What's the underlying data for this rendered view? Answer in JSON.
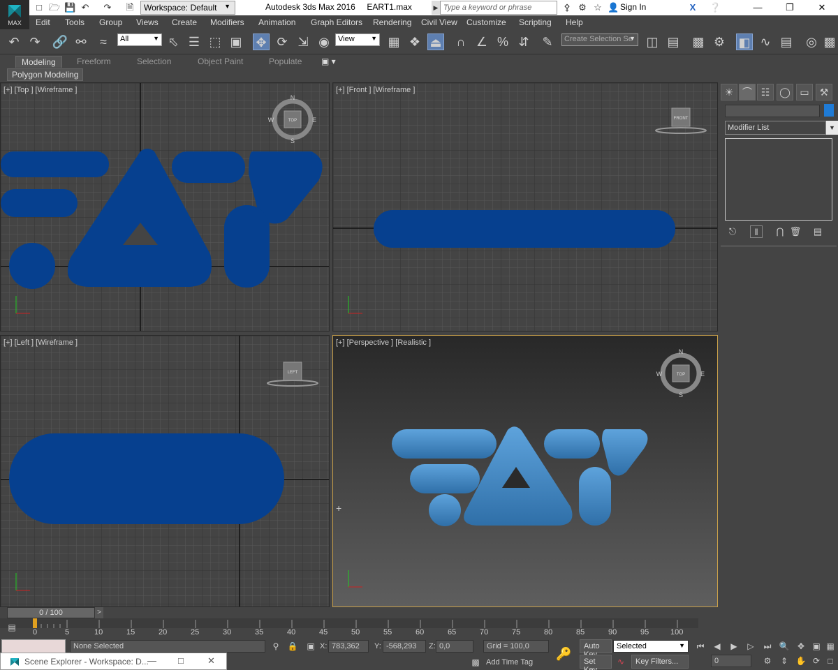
{
  "app": {
    "logo_label": "MAX",
    "title": "Autodesk 3ds Max 2016     EART1.max",
    "workspace": "Workspace: Default",
    "search_placeholder": "Type a keyword or phrase",
    "sign_in": "Sign In"
  },
  "menu": [
    "Edit",
    "Tools",
    "Group",
    "Views",
    "Create",
    "Modifiers",
    "Animation",
    "Graph Editors",
    "Rendering",
    "Civil View",
    "Customize",
    "Scripting",
    "Help"
  ],
  "toolbar": {
    "selection_filter": "All",
    "reference_coord": "View",
    "named_selection_placeholder": "Create Selection Se"
  },
  "ribbon": {
    "tabs": [
      "Modeling",
      "Freeform",
      "Selection",
      "Object Paint",
      "Populate"
    ],
    "active_tab": "Modeling",
    "panel": "Polygon Modeling"
  },
  "viewports": {
    "top": {
      "label": "[+] [Top ] [Wireframe ]",
      "cube": "TOP"
    },
    "front": {
      "label": "[+] [Front ] [Wireframe ]",
      "cube": "FRONT"
    },
    "left": {
      "label": "[+] [Left ] [Wireframe ]",
      "cube": "LEFT"
    },
    "perspective": {
      "label": "[+] [Perspective ] [Realistic ]",
      "cube": "TOP"
    },
    "compass": {
      "n": "N",
      "s": "S",
      "e": "E",
      "w": "W"
    },
    "object_color": "#06408f",
    "shaded_color": "#3c86c8"
  },
  "command_panel": {
    "modifier_list": "Modifier List",
    "object_color": "#1f7bd6"
  },
  "time": {
    "slider": "0 / 100",
    "ticks": [
      "0",
      "5",
      "10",
      "15",
      "20",
      "25",
      "30",
      "35",
      "40",
      "45",
      "50",
      "55",
      "60",
      "65",
      "70",
      "75",
      "80",
      "85",
      "90",
      "95",
      "100"
    ]
  },
  "status": {
    "selection": "None Selected",
    "x_label": "X:",
    "x_value": "783,362",
    "y_label": "Y:",
    "y_value": "-568,293",
    "z_label": "Z:",
    "z_value": "0,0",
    "grid": "Grid = 100,0",
    "add_time_tag": "Add Time Tag",
    "auto_key": "Auto Key",
    "set_key": "Set Key",
    "key_mode": "Selected",
    "key_filters": "Key Filters...",
    "frame": "0"
  },
  "scene_explorer": {
    "title": "Scene Explorer - Workspace: D..."
  }
}
